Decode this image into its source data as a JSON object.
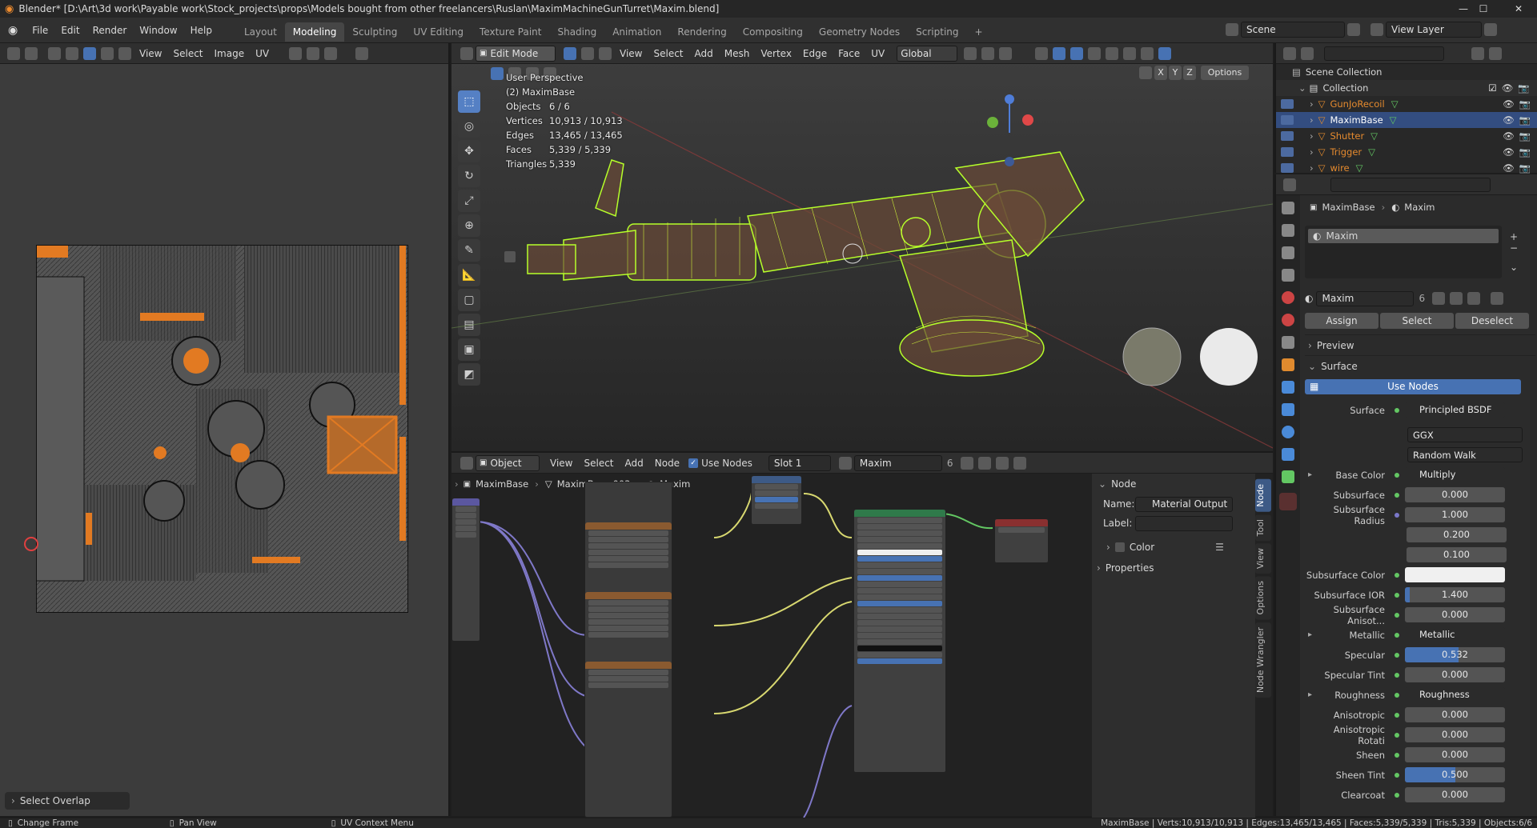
{
  "titlebar": {
    "title": "Blender* [D:\\Art\\3d work\\Payable work\\Stock_projects\\props\\Models bought from other freelancers\\Ruslan\\MaximMachineGunTurret\\Maxim.blend]",
    "min": "—",
    "max": "☐",
    "close": "✕"
  },
  "menu": {
    "file": "File",
    "edit": "Edit",
    "render": "Render",
    "window": "Window",
    "help": "Help"
  },
  "workspaces": [
    "Layout",
    "Modeling",
    "Sculpting",
    "UV Editing",
    "Texture Paint",
    "Shading",
    "Animation",
    "Rendering",
    "Compositing",
    "Geometry Nodes",
    "Scripting"
  ],
  "active_workspace": "Modeling",
  "scene": {
    "name": "Scene",
    "view_layer": "View Layer"
  },
  "uv_editor": {
    "menus": [
      "View",
      "Select",
      "Image",
      "UV"
    ],
    "overlay_panel": "Select Overlap"
  },
  "viewport": {
    "mode": "Edit Mode",
    "menus": [
      "View",
      "Select",
      "Add",
      "Mesh",
      "Vertex",
      "Edge",
      "Face",
      "UV"
    ],
    "orientation": "Global",
    "options": "Options",
    "axes": [
      "X",
      "Y",
      "Z"
    ],
    "perspective": "User Perspective",
    "object": "(2) MaximBase",
    "stats": [
      {
        "label": "Objects",
        "value": "6 / 6"
      },
      {
        "label": "Vertices",
        "value": "10,913 / 10,913"
      },
      {
        "label": "Edges",
        "value": "13,465 / 13,465"
      },
      {
        "label": "Faces",
        "value": "5,339 / 5,339"
      },
      {
        "label": "Triangles",
        "value": "5,339"
      }
    ]
  },
  "node_editor": {
    "mode": "Object",
    "menus": [
      "View",
      "Select",
      "Add",
      "Node"
    ],
    "use_nodes": "Use Nodes",
    "slot": "Slot 1",
    "material": "Maxim",
    "users": "6",
    "breadcrumb": [
      "MaximBase",
      "MaximBase.003",
      "Maxim"
    ],
    "side_panel": {
      "title": "Node",
      "name_label": "Name:",
      "name_value": "Material Output",
      "label_label": "Label:",
      "label_value": "",
      "color": "Color",
      "properties": "Properties"
    },
    "vtabs": [
      "Node",
      "Tool",
      "View",
      "Options",
      "Node Wrangler"
    ]
  },
  "outliner": {
    "root": "Scene Collection",
    "collection": "Collection",
    "items": [
      {
        "name": "GunJoRecoil",
        "color": "#e58a2e"
      },
      {
        "name": "MaximBase",
        "color": "#ffffff"
      },
      {
        "name": "Shutter",
        "color": "#e58a2e"
      },
      {
        "name": "Trigger",
        "color": "#e58a2e"
      },
      {
        "name": "wire",
        "color": "#e58a2e"
      }
    ]
  },
  "properties": {
    "breadcrumb": [
      "MaximBase",
      "Maxim"
    ],
    "slot": "Maxim",
    "material": "Maxim",
    "users": "6",
    "buttons": [
      "Assign",
      "Select",
      "Deselect"
    ],
    "preview": "Preview",
    "surface_section": "Surface",
    "use_nodes": "Use Nodes",
    "surface_label": "Surface",
    "surface_value": "Principled BSDF",
    "distribution": "GGX",
    "subsurface_method": "Random Walk",
    "rows": [
      {
        "label": "Base Color",
        "value": "Multiply",
        "kind": "link",
        "expand": true
      },
      {
        "label": "Subsurface",
        "value": "0.000",
        "kind": "num"
      },
      {
        "label": "Subsurface Radius",
        "value": "1.000",
        "kind": "vec"
      },
      {
        "label": "",
        "value": "0.200",
        "kind": "vec2"
      },
      {
        "label": "",
        "value": "0.100",
        "kind": "vec2"
      },
      {
        "label": "Subsurface Color",
        "value": "",
        "kind": "color"
      },
      {
        "label": "Subsurface IOR",
        "value": "1.400",
        "kind": "num",
        "fill": 0.05
      },
      {
        "label": "Subsurface Anisot...",
        "value": "0.000",
        "kind": "num"
      },
      {
        "label": "Metallic",
        "value": "Metallic",
        "kind": "link",
        "expand": true
      },
      {
        "label": "Specular",
        "value": "0.532",
        "kind": "num",
        "fill": 0.532
      },
      {
        "label": "Specular Tint",
        "value": "0.000",
        "kind": "num"
      },
      {
        "label": "Roughness",
        "value": "Roughness",
        "kind": "link",
        "expand": true
      },
      {
        "label": "Anisotropic",
        "value": "0.000",
        "kind": "num"
      },
      {
        "label": "Anisotropic Rotati",
        "value": "0.000",
        "kind": "num"
      },
      {
        "label": "Sheen",
        "value": "0.000",
        "kind": "num"
      },
      {
        "label": "Sheen Tint",
        "value": "0.500",
        "kind": "num",
        "fill": 0.5
      },
      {
        "label": "Clearcoat",
        "value": "0.000",
        "kind": "num"
      }
    ]
  },
  "statusbar": {
    "change_frame": "Change Frame",
    "pan_view": "Pan View",
    "uv_context": "UV Context Menu",
    "stats": "MaximBase | Verts:10,913/10,913 | Edges:13,465/13,465 | Faces:5,339/5,339 | Tris:5,339 | Objects:6/6"
  }
}
